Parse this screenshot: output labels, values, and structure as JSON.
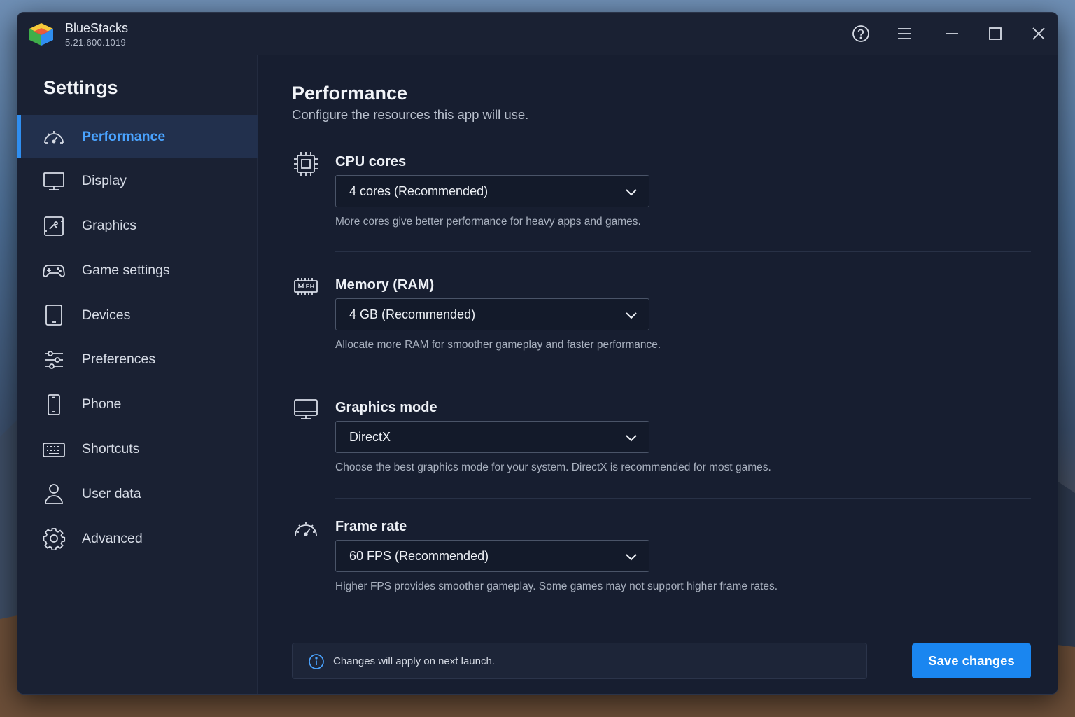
{
  "app": {
    "title": "BlueStacks",
    "version": "5.21.600.1019"
  },
  "titlebar": {
    "icons": [
      "help-icon",
      "menu-icon",
      "minimize-icon",
      "maximize-icon",
      "close-icon"
    ]
  },
  "sidebar": {
    "title": "Settings",
    "items": [
      {
        "label": "Performance",
        "icon": "gauge-icon",
        "active": true
      },
      {
        "label": "Display",
        "icon": "monitor-icon"
      },
      {
        "label": "Graphics",
        "icon": "graphics-icon"
      },
      {
        "label": "Game settings",
        "icon": "gamepad-icon"
      },
      {
        "label": "Devices",
        "icon": "tablet-icon"
      },
      {
        "label": "Preferences",
        "icon": "sliders-icon"
      },
      {
        "label": "Phone",
        "icon": "phone-icon"
      },
      {
        "label": "Shortcuts",
        "icon": "keyboard-icon"
      },
      {
        "label": "User data",
        "icon": "user-icon"
      },
      {
        "label": "Advanced",
        "icon": "gear-icon"
      }
    ]
  },
  "main": {
    "title": "Performance",
    "subtitle": "Configure the resources this app will use.",
    "sections": [
      {
        "label": "CPU cores",
        "icon": "cpu-icon",
        "value": "4 cores (Recommended)",
        "help": "More cores give better performance for heavy apps and games."
      },
      {
        "label": "Memory (RAM)",
        "icon": "memory-icon",
        "value": "4 GB (Recommended)",
        "help": "Allocate more RAM for smoother gameplay and faster performance."
      },
      {
        "label": "Graphics mode",
        "icon": "monitor-icon",
        "value": "DirectX",
        "help": "Choose the best graphics mode for your system. DirectX is recommended for most games."
      },
      {
        "label": "Frame rate",
        "icon": "gauge-icon",
        "value": "60 FPS (Recommended)",
        "help": "Higher FPS provides smoother gameplay. Some games may not support higher frame rates."
      }
    ],
    "info": "Changes will apply on next launch.",
    "save_label": "Save changes"
  },
  "colors": {
    "accent": "#1a86f0",
    "active_text": "#4aa3ff",
    "window_bg": "#171e30",
    "sidebar_bg": "#1a2133"
  }
}
